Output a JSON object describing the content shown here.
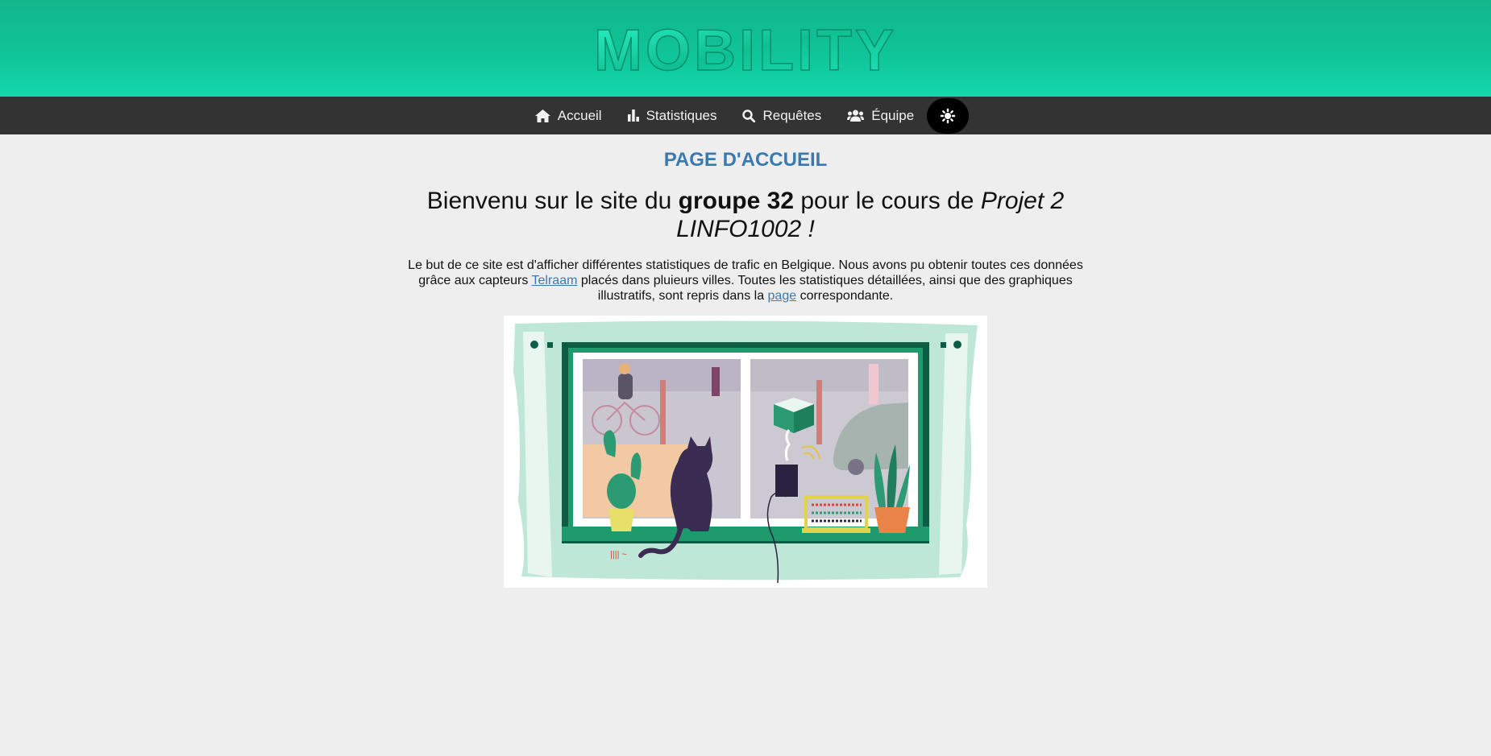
{
  "brand": {
    "logo_text": "MOBILITY"
  },
  "nav": {
    "items": [
      {
        "label": "Accueil",
        "icon": "home-icon"
      },
      {
        "label": "Statistiques",
        "icon": "bar-chart-icon"
      },
      {
        "label": "Requêtes",
        "icon": "search-icon"
      },
      {
        "label": "Équipe",
        "icon": "users-icon"
      }
    ],
    "theme_toggle_icon": "sun-icon"
  },
  "main": {
    "page_title": "PAGE D'ACCUEIL",
    "welcome": {
      "part1": "Bienvenu sur le site du ",
      "group": "groupe 32",
      "part2": " pour le cours de ",
      "course": "Projet 2 LINFO1002 !"
    },
    "intro": {
      "text1": "Le but de ce site est d'afficher différentes statistiques de trafic en Belgique. Nous avons pu obtenir toutes ces données grâce aux capteurs ",
      "link1": "Telraam",
      "text2": " placés dans pluieurs villes. Toutes les statistiques détaillées, ainsi que des graphiques illustratifs, sont repris dans la ",
      "link2": "page",
      "text3": " correspondante."
    }
  },
  "colors": {
    "header_green": "#12b68b",
    "nav_bg": "#333333",
    "title_blue": "#3a7ab0",
    "page_bg": "#eeeeee"
  }
}
